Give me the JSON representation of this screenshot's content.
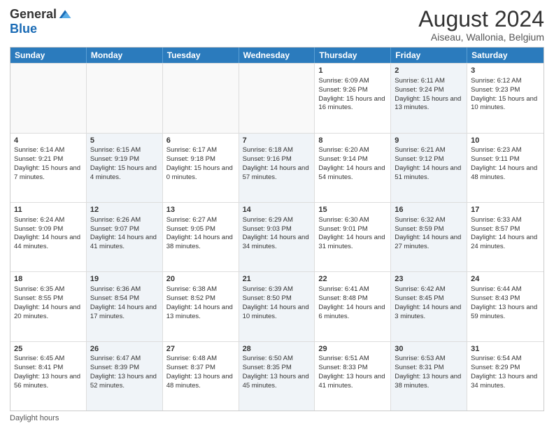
{
  "logo": {
    "general": "General",
    "blue": "Blue"
  },
  "title": "August 2024",
  "subtitle": "Aiseau, Wallonia, Belgium",
  "days": [
    "Sunday",
    "Monday",
    "Tuesday",
    "Wednesday",
    "Thursday",
    "Friday",
    "Saturday"
  ],
  "footer": "Daylight hours",
  "weeks": [
    [
      {
        "day": "",
        "info": "",
        "shaded": false
      },
      {
        "day": "",
        "info": "",
        "shaded": false
      },
      {
        "day": "",
        "info": "",
        "shaded": false
      },
      {
        "day": "",
        "info": "",
        "shaded": false
      },
      {
        "day": "1",
        "info": "Sunrise: 6:09 AM\nSunset: 9:26 PM\nDaylight: 15 hours and 16 minutes.",
        "shaded": false
      },
      {
        "day": "2",
        "info": "Sunrise: 6:11 AM\nSunset: 9:24 PM\nDaylight: 15 hours and 13 minutes.",
        "shaded": true
      },
      {
        "day": "3",
        "info": "Sunrise: 6:12 AM\nSunset: 9:23 PM\nDaylight: 15 hours and 10 minutes.",
        "shaded": false
      }
    ],
    [
      {
        "day": "4",
        "info": "Sunrise: 6:14 AM\nSunset: 9:21 PM\nDaylight: 15 hours and 7 minutes.",
        "shaded": false
      },
      {
        "day": "5",
        "info": "Sunrise: 6:15 AM\nSunset: 9:19 PM\nDaylight: 15 hours and 4 minutes.",
        "shaded": true
      },
      {
        "day": "6",
        "info": "Sunrise: 6:17 AM\nSunset: 9:18 PM\nDaylight: 15 hours and 0 minutes.",
        "shaded": false
      },
      {
        "day": "7",
        "info": "Sunrise: 6:18 AM\nSunset: 9:16 PM\nDaylight: 14 hours and 57 minutes.",
        "shaded": true
      },
      {
        "day": "8",
        "info": "Sunrise: 6:20 AM\nSunset: 9:14 PM\nDaylight: 14 hours and 54 minutes.",
        "shaded": false
      },
      {
        "day": "9",
        "info": "Sunrise: 6:21 AM\nSunset: 9:12 PM\nDaylight: 14 hours and 51 minutes.",
        "shaded": true
      },
      {
        "day": "10",
        "info": "Sunrise: 6:23 AM\nSunset: 9:11 PM\nDaylight: 14 hours and 48 minutes.",
        "shaded": false
      }
    ],
    [
      {
        "day": "11",
        "info": "Sunrise: 6:24 AM\nSunset: 9:09 PM\nDaylight: 14 hours and 44 minutes.",
        "shaded": false
      },
      {
        "day": "12",
        "info": "Sunrise: 6:26 AM\nSunset: 9:07 PM\nDaylight: 14 hours and 41 minutes.",
        "shaded": true
      },
      {
        "day": "13",
        "info": "Sunrise: 6:27 AM\nSunset: 9:05 PM\nDaylight: 14 hours and 38 minutes.",
        "shaded": false
      },
      {
        "day": "14",
        "info": "Sunrise: 6:29 AM\nSunset: 9:03 PM\nDaylight: 14 hours and 34 minutes.",
        "shaded": true
      },
      {
        "day": "15",
        "info": "Sunrise: 6:30 AM\nSunset: 9:01 PM\nDaylight: 14 hours and 31 minutes.",
        "shaded": false
      },
      {
        "day": "16",
        "info": "Sunrise: 6:32 AM\nSunset: 8:59 PM\nDaylight: 14 hours and 27 minutes.",
        "shaded": true
      },
      {
        "day": "17",
        "info": "Sunrise: 6:33 AM\nSunset: 8:57 PM\nDaylight: 14 hours and 24 minutes.",
        "shaded": false
      }
    ],
    [
      {
        "day": "18",
        "info": "Sunrise: 6:35 AM\nSunset: 8:55 PM\nDaylight: 14 hours and 20 minutes.",
        "shaded": false
      },
      {
        "day": "19",
        "info": "Sunrise: 6:36 AM\nSunset: 8:54 PM\nDaylight: 14 hours and 17 minutes.",
        "shaded": true
      },
      {
        "day": "20",
        "info": "Sunrise: 6:38 AM\nSunset: 8:52 PM\nDaylight: 14 hours and 13 minutes.",
        "shaded": false
      },
      {
        "day": "21",
        "info": "Sunrise: 6:39 AM\nSunset: 8:50 PM\nDaylight: 14 hours and 10 minutes.",
        "shaded": true
      },
      {
        "day": "22",
        "info": "Sunrise: 6:41 AM\nSunset: 8:48 PM\nDaylight: 14 hours and 6 minutes.",
        "shaded": false
      },
      {
        "day": "23",
        "info": "Sunrise: 6:42 AM\nSunset: 8:45 PM\nDaylight: 14 hours and 3 minutes.",
        "shaded": true
      },
      {
        "day": "24",
        "info": "Sunrise: 6:44 AM\nSunset: 8:43 PM\nDaylight: 13 hours and 59 minutes.",
        "shaded": false
      }
    ],
    [
      {
        "day": "25",
        "info": "Sunrise: 6:45 AM\nSunset: 8:41 PM\nDaylight: 13 hours and 56 minutes.",
        "shaded": false
      },
      {
        "day": "26",
        "info": "Sunrise: 6:47 AM\nSunset: 8:39 PM\nDaylight: 13 hours and 52 minutes.",
        "shaded": true
      },
      {
        "day": "27",
        "info": "Sunrise: 6:48 AM\nSunset: 8:37 PM\nDaylight: 13 hours and 48 minutes.",
        "shaded": false
      },
      {
        "day": "28",
        "info": "Sunrise: 6:50 AM\nSunset: 8:35 PM\nDaylight: 13 hours and 45 minutes.",
        "shaded": true
      },
      {
        "day": "29",
        "info": "Sunrise: 6:51 AM\nSunset: 8:33 PM\nDaylight: 13 hours and 41 minutes.",
        "shaded": false
      },
      {
        "day": "30",
        "info": "Sunrise: 6:53 AM\nSunset: 8:31 PM\nDaylight: 13 hours and 38 minutes.",
        "shaded": true
      },
      {
        "day": "31",
        "info": "Sunrise: 6:54 AM\nSunset: 8:29 PM\nDaylight: 13 hours and 34 minutes.",
        "shaded": false
      }
    ]
  ]
}
